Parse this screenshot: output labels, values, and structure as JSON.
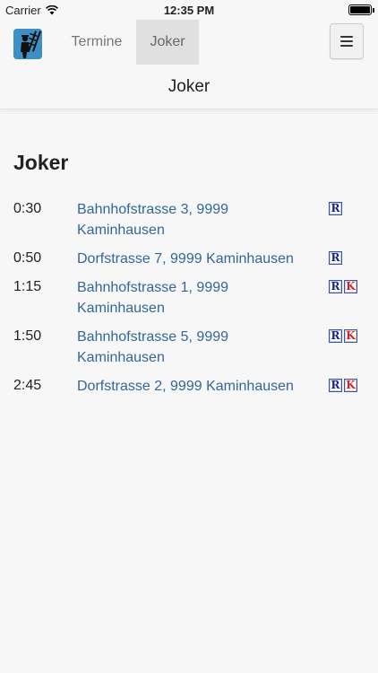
{
  "status_bar": {
    "carrier": "Carrier",
    "time": "12:35 PM"
  },
  "nav": {
    "tabs": [
      {
        "label": "Termine",
        "active": false
      },
      {
        "label": "Joker",
        "active": true
      }
    ]
  },
  "subheader": {
    "title": "Joker"
  },
  "main": {
    "heading": "Joker",
    "entries": [
      {
        "time": "0:30",
        "address": "Bahnhofstrasse 3, 9999 Kaminhausen",
        "badges": [
          "R"
        ]
      },
      {
        "time": "0:50",
        "address": "Dorfstrasse 7, 9999 Kaminhausen",
        "badges": [
          "R"
        ]
      },
      {
        "time": "1:15",
        "address": "Bahnhofstrasse 1, 9999 Kaminhausen",
        "badges": [
          "R",
          "K"
        ]
      },
      {
        "time": "1:50",
        "address": "Bahnhofstrasse 5, 9999 Kaminhausen",
        "badges": [
          "R",
          "K"
        ]
      },
      {
        "time": "2:45",
        "address": "Dorfstrasse 2, 9999 Kaminhausen",
        "badges": [
          "R",
          "K"
        ]
      }
    ]
  },
  "colors": {
    "link": "#336699",
    "badge_r": "#1a237e",
    "badge_k": "#c62828",
    "logo_bg": "#3d8fc4"
  },
  "icons": {
    "menu": "hamburger-icon",
    "logo": "chimney-sweep-logo-icon",
    "wifi": "wifi-icon",
    "battery": "battery-icon"
  }
}
